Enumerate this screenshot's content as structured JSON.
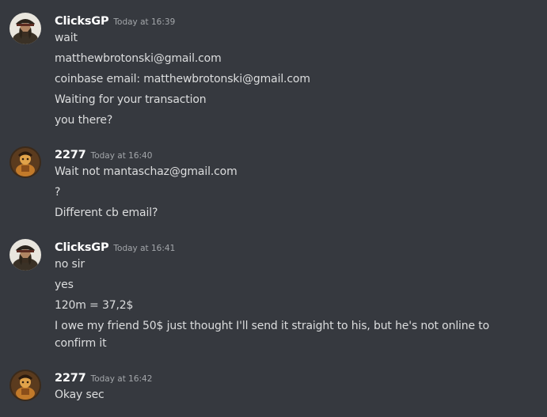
{
  "groups": [
    {
      "username": "ClicksGP",
      "timestamp": "Today at 16:39",
      "avatar_icon": "pirate-avatar-icon",
      "messages": [
        "wait",
        "matthewbrotonski@gmail.com",
        "coinbase email: matthewbrotonski@gmail.com",
        "Waiting for your transaction",
        "you there?"
      ]
    },
    {
      "username": "2277",
      "timestamp": "Today at 16:40",
      "avatar_icon": "treasure-avatar-icon",
      "messages": [
        "Wait not mantaschaz@gmail.com",
        "?",
        "Different cb email?"
      ]
    },
    {
      "username": "ClicksGP",
      "timestamp": "Today at 16:41",
      "avatar_icon": "pirate-avatar-icon",
      "messages": [
        "no sir",
        "yes",
        "120m = 37,2$",
        "I owe my friend 50$ just thought I'll send it straight to his, but he's not online to confirm it"
      ]
    },
    {
      "username": "2277",
      "timestamp": "Today at 16:42",
      "avatar_icon": "treasure-avatar-icon",
      "messages": [
        "Okay sec"
      ]
    }
  ],
  "colors": {
    "background": "#36393f",
    "username": "#ffffff",
    "timestamp": "#a3a6aa",
    "message_text": "#dcddde"
  }
}
